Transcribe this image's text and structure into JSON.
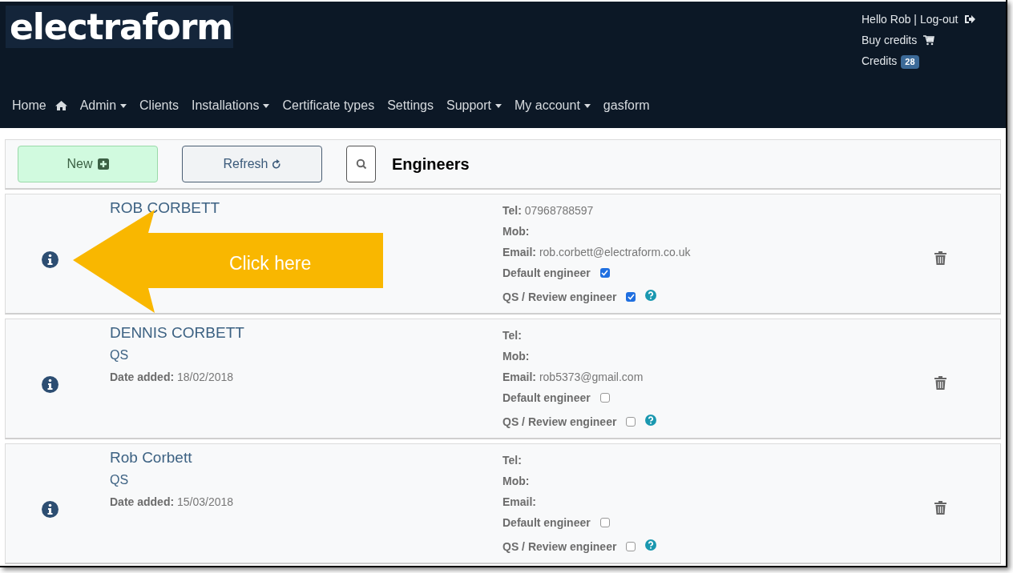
{
  "header": {
    "logo": "electraform",
    "user_links": [
      {
        "text": "Hello Rob | Log-out",
        "kind": "logout"
      },
      {
        "text": "Buy credits",
        "kind": "cart"
      },
      {
        "text": "Credits",
        "kind": "credits",
        "badge": "28"
      }
    ]
  },
  "nav": [
    {
      "label": "Home",
      "kind": "home"
    },
    {
      "label": "Admin",
      "kind": "dropdown"
    },
    {
      "label": "Clients",
      "kind": "link"
    },
    {
      "label": "Installations",
      "kind": "dropdown"
    },
    {
      "label": "Certificate types",
      "kind": "link"
    },
    {
      "label": "Settings",
      "kind": "link"
    },
    {
      "label": "Support",
      "kind": "dropdown"
    },
    {
      "label": "My account",
      "kind": "dropdown"
    },
    {
      "label": "gasform",
      "kind": "link"
    }
  ],
  "toolbar": {
    "new_button": "New",
    "refresh_button": "Refresh",
    "title": "Engineers"
  },
  "engineers": [
    {
      "name": "ROB CORBETT",
      "fields": [
        {
          "label": "Tel:",
          "value": "07968788597"
        },
        {
          "label": "Mob:"
        },
        {
          "label": "Email:",
          "value": "rob.corbett@electraform.co.uk"
        }
      ],
      "default_label": "Default engineer",
      "default_engineer": true,
      "qs_label": "QS / Review engineer",
      "qs_review": true
    },
    {
      "name": "DENNIS CORBETT",
      "role": "QS",
      "date_label": "Date added:",
      "date_added": "18/02/2018",
      "fields": [
        {
          "label": "Tel:"
        },
        {
          "label": "Mob:"
        },
        {
          "label": "Email:",
          "value": "rob5373@gmail.com"
        }
      ],
      "default_label": "Default engineer",
      "default_engineer": false,
      "qs_label": "QS / Review engineer",
      "qs_review": false
    },
    {
      "name": "Rob Corbett",
      "role": "QS",
      "date_label": "Date added:",
      "date_added": "15/03/2018",
      "fields": [
        {
          "label": "Tel:"
        },
        {
          "label": "Mob:"
        },
        {
          "label": "Email:"
        }
      ],
      "default_label": "Default engineer",
      "default_engineer": false,
      "qs_label": "QS / Review engineer",
      "qs_review": false
    }
  ],
  "callout": {
    "text": "Click here"
  }
}
